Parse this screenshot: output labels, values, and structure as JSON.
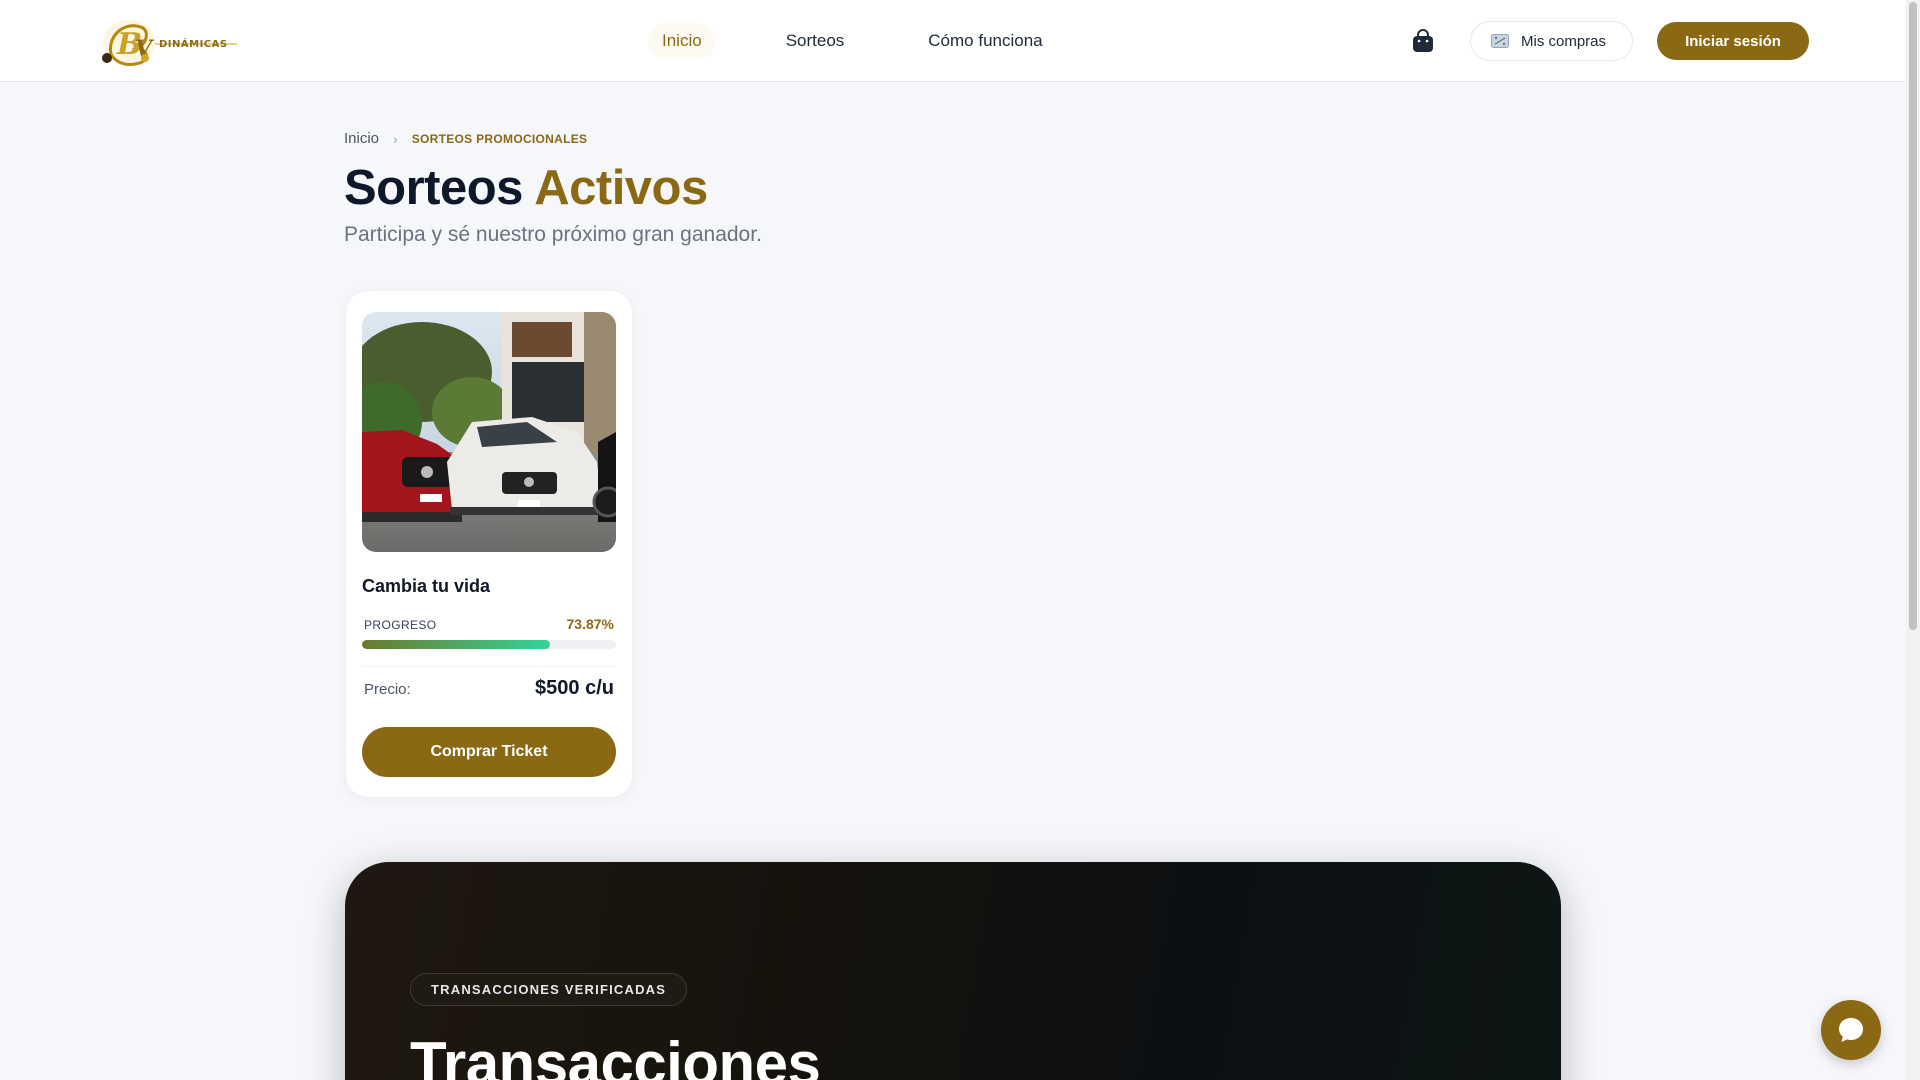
{
  "header": {
    "logo_text": "DINÁMICAS",
    "nav": [
      {
        "label": "Inicio",
        "active": true
      },
      {
        "label": "Sorteos",
        "active": false
      },
      {
        "label": "Cómo funciona",
        "active": false
      }
    ],
    "cart_icon": "shopping-bag-icon",
    "mis_compras_label": "Mis compras",
    "login_label": "Iniciar sesión"
  },
  "breadcrumb": {
    "home": "Inicio",
    "current": "SORTEOS PROMOCIONALES"
  },
  "page": {
    "title_main": "Sorteos",
    "title_accent": "Activos",
    "subtitle": "Participa y sé nuestro próximo gran ganador."
  },
  "raffle_card": {
    "title": "Cambia tu vida",
    "progress_label": "PROGRESO",
    "progress_text": "73.87%",
    "progress_fraction": 0.7387,
    "price_label": "Precio:",
    "price_value": "$500 c/u",
    "button_label": "Comprar Ticket"
  },
  "transactions": {
    "badge": "TRANSACCIONES VERIFICADAS",
    "title": "Transacciones"
  },
  "colors": {
    "accent": "#8b6914",
    "progress_start": "#6b7a2a",
    "progress_end": "#34d399"
  }
}
